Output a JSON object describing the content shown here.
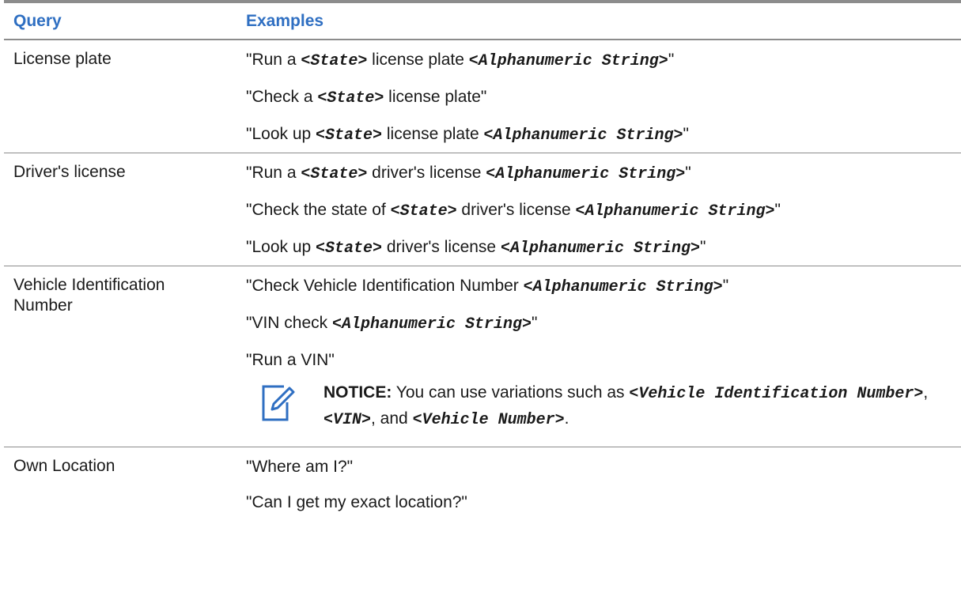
{
  "table": {
    "headers": {
      "query": "Query",
      "examples": "Examples"
    },
    "rows": [
      {
        "query": "License plate",
        "examples": [
          {
            "p1": "\"Run a ",
            "m1": "<State>",
            "p2": " license plate ",
            "m2": "<Alphanumeric String>",
            "p3": "\""
          },
          {
            "p1": "\"Check a ",
            "m1": "<State>",
            "p2": " license plate\""
          },
          {
            "p1": "\"Look up ",
            "m1": "<State>",
            "p2": " license plate ",
            "m2": "<Alphanumeric String>",
            "p3": "\""
          }
        ]
      },
      {
        "query": "Driver's license",
        "examples": [
          {
            "p1": "\"Run a ",
            "m1": "<State>",
            "p2": " driver's license ",
            "m2": "<Alphanumeric String>",
            "p3": "\""
          },
          {
            "p1": "\"Check the state of ",
            "m1": "<State>",
            "p2": " driver's license ",
            "m2": "<Alphanumeric String>",
            "p3": "\""
          },
          {
            "p1": "\"Look up ",
            "m1": "<State>",
            "p2": " driver's license ",
            "m2": "<Alphanumeric String>",
            "p3": "\""
          }
        ]
      },
      {
        "query": "Vehicle Identification Number",
        "examples": [
          {
            "p1": "\"Check Vehicle Identification Number ",
            "m1": "<Alphanumeric String>",
            "p2": "\""
          },
          {
            "p1": "\"VIN check ",
            "m1": "<Alphanumeric String>",
            "p2": "\""
          },
          {
            "p1": "\"Run a VIN\""
          }
        ],
        "notice": {
          "label": "NOTICE:",
          "t1": " You can use variations such as ",
          "m1": "<Vehicle Identification Number>",
          "t2": ", ",
          "m2": "<VIN>",
          "t3": ", and ",
          "m3": "<Vehicle Number>",
          "t4": ".",
          "icon": "pencil-note-icon",
          "icon_color": "#2f6fc2"
        }
      },
      {
        "query": "Own Location",
        "examples": [
          {
            "p1": "\"Where am I?\""
          },
          {
            "p1": "\"Can I get my exact location?\""
          }
        ]
      }
    ]
  },
  "colors": {
    "header_text": "#2f6fc2",
    "rule": "#8c8c8c",
    "body_text": "#1a1a1a"
  }
}
